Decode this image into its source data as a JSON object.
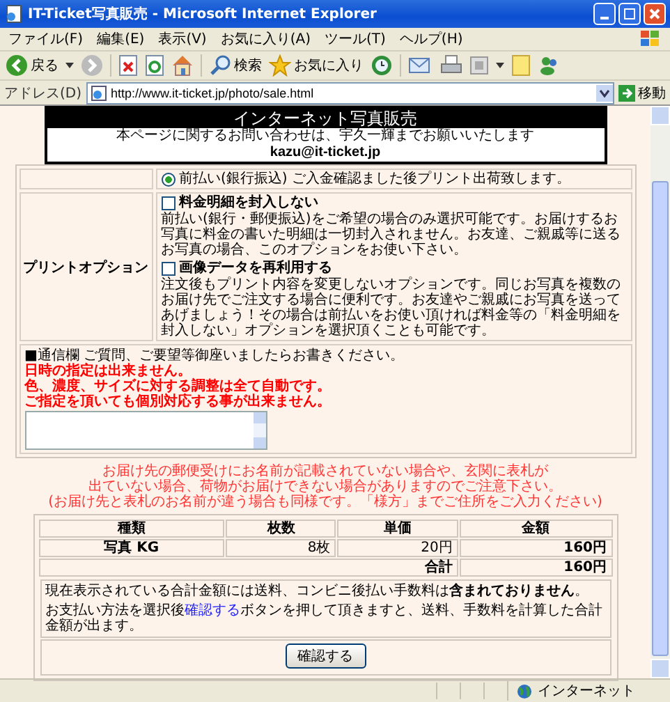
{
  "window": {
    "title": "IT-Ticket写真販売 - Microsoft Internet Explorer"
  },
  "menu": [
    "ファイル(F)",
    "編集(E)",
    "表示(V)",
    "お気に入り(A)",
    "ツール(T)",
    "ヘルプ(H)"
  ],
  "toolbar": {
    "back": "戻る",
    "search": "検索",
    "favorites": "お気に入り"
  },
  "address_bar": {
    "label": "アドレス(D)",
    "url": "http://www.it-ticket.jp/photo/sale.html",
    "go": "移動"
  },
  "header": {
    "title": "インターネット写真販売",
    "contact": "本ページに関するお問い合わせは、宇久一輝までお願いいたします",
    "email": "kazu@it-ticket.jp"
  },
  "payment": {
    "option": "前払い(銀行振込)",
    "selected": true,
    "note": "ご入金確認ました後プリント出荷致します。"
  },
  "print_options": {
    "label": "プリントオプション",
    "options": [
      {
        "title": "料金明細を封入しない",
        "checked": false,
        "description": "前払い(銀行・郵便振込)をご希望の場合のみ選択可能です。お届けするお写真に料金の書いた明細は一切封入されません。お友達、ご親戚等に送るお写真の場合、このオプションをお使い下さい。"
      },
      {
        "title": "画像データを再利用する",
        "checked": false,
        "description": "注文後もプリント内容を変更しないオプションです。同じお写真を複数のお届け先でご注文する場合に便利です。お友達やご親戚にお写真を送ってあげましょう！その場合は前払いをお使い頂ければ料金等の「料金明細を封入しない」オプションを選択頂くことも可能です。"
      }
    ]
  },
  "message": {
    "prompt": "■通信欄 ご質問、ご要望等御座いましたらお書きください。",
    "warnings": [
      "日時の指定は出来ません。",
      "色、濃度、サイズに対する調整は全て自動です。",
      "ご指定を頂いても個別対応する事が出来ません。"
    ]
  },
  "delivery_notice": [
    "お届け先の郵便受けにお名前が記載されていない場合や、玄関に表札が",
    "出ていない場合、荷物がお届けできない場合がありますのでご注意下さい。",
    "(お届け先と表札のお名前が違う場合も同様です。「様方」までご住所をご入力ください)"
  ],
  "order_table": {
    "columns": [
      "種類",
      "枚数",
      "単価",
      "金額"
    ],
    "rows": [
      [
        "写真 KG",
        "8枚",
        "20円",
        "160円"
      ]
    ],
    "total_label": "合計",
    "total": "160円"
  },
  "summary": {
    "note": "現在表示されている合計金額には送料、コンビニ後払い手数料は**含まれておりません**。",
    "instruction_before": "お支払い方法を選択後",
    "instruction_link": "確認する",
    "instruction_after": "ボタンを押して頂きますと、送料、手数料を計算した合計金額が出ます。",
    "button": "確認する"
  },
  "status_bar": {
    "zone": "インターネット"
  }
}
